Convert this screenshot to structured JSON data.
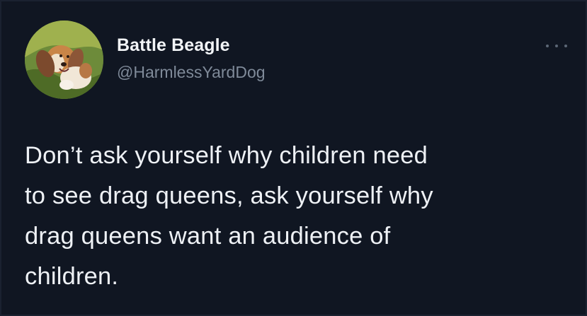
{
  "tweet": {
    "display_name": "Battle Beagle",
    "handle": "@HarmlessYardDog",
    "text": "Don’t ask yourself why children need\nto see drag queens, ask yourself why\ndrag queens want an audience of\nchildren."
  },
  "icons": {
    "avatar": "beagle-avatar-photo",
    "more": "more-options-icon"
  },
  "colors": {
    "background": "#101622",
    "primary_text": "#eef1f5",
    "secondary_text": "#7f8a99"
  }
}
